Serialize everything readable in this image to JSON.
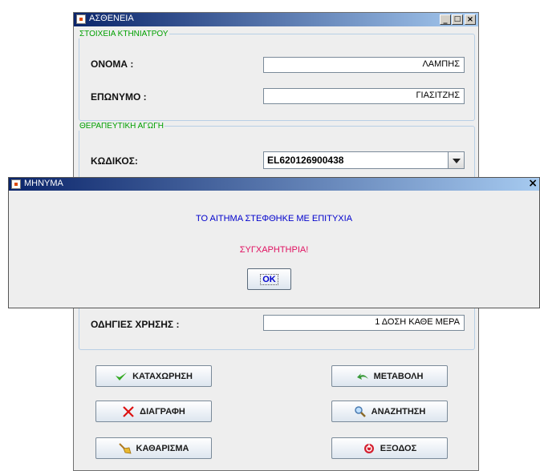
{
  "main_window": {
    "title": "ΑΣΘΕΝΕΙΑ",
    "controls": {
      "minimize": "_",
      "maximize": "□",
      "close": "×"
    },
    "vet_section": {
      "legend": "ΣΤΟΙΧΕΙΑ ΚΤΗΝΙΑΤΡΟΥ",
      "name_label": "ΟΝΟΜΑ :",
      "name_value": "ΛΑΜΠΗΣ",
      "surname_label": "ΕΠΩΝΥΜΟ :",
      "surname_value": "ΓΙΑΣΙΤΖΗΣ"
    },
    "treatment_section": {
      "legend": "ΘΕΡΑΠΕΥΤΙΚΗ ΑΓΩΓΗ",
      "code_label": "ΚΩΔΙΚΟΣ:",
      "code_value": "EL620126900438",
      "instructions_label": "ΟΔΗΓΙΕΣ ΧΡΗΣΗΣ :",
      "instructions_value": "1 ΔΟΣΗ ΚΑΘΕ ΜΕΡΑ"
    },
    "buttons": {
      "save": "ΚΑΤΑΧΩΡΗΣΗ",
      "modify": "ΜΕΤΑΒΟΛΗ",
      "delete": "ΔΙΑΓΡΑΦΗ",
      "search": "ΑΝΑΖΗΤΗΣΗ",
      "clear": "ΚΑΘΑΡΙΣΜΑ",
      "exit": "ΕΞΟΔΟΣ"
    }
  },
  "dialog": {
    "title": "ΜΗΝΥΜΑ",
    "close": "×",
    "message": "ΤΟ ΑΙΤΗΜΑ ΣΤΕΦΘΗΚΕ ΜΕ ΕΠΙΤΥΧΙΑ",
    "congrats": "ΣΥΓΧΑΡΗΤΗΡΙΑ!",
    "ok": "OK"
  },
  "colors": {
    "legend_green": "#00a000",
    "message_blue": "#0000cc",
    "congrats_pink": "#e01060",
    "titlebar_dark": "#0a246a"
  },
  "icons": [
    "java-app-icon",
    "checkmark-icon",
    "undo-arrow-icon",
    "red-x-icon",
    "magnifier-icon",
    "broom-icon",
    "exit-icon"
  ]
}
